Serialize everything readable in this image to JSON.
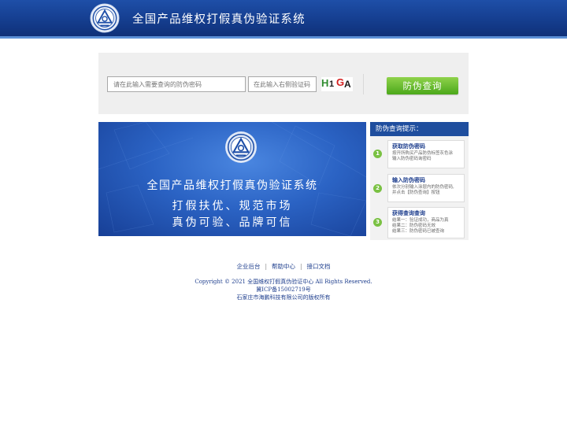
{
  "header": {
    "title": "全国产品维权打假真伪验证系统"
  },
  "search": {
    "code_placeholder": "请在此输入需要查询的防伪密码",
    "verify_placeholder": "在此输入右侧验证码",
    "captcha": [
      "H",
      "1",
      "G",
      "A"
    ],
    "captcha_colors": [
      "#2e8b2e",
      "#1a1a1a",
      "#d42020",
      "#1a1a1a"
    ],
    "button_label": "防伪查询"
  },
  "banner": {
    "title": "全国产品维权打假真伪验证系统",
    "slogan_line1": "打假扶优、规范市场",
    "slogan_line2": "真伪可验、品牌可信"
  },
  "tips": {
    "heading": "防伪查询提示：",
    "items": [
      {
        "num": "1",
        "title": "获取防伪密码",
        "desc1": "按开所购买产品防伪标签灰色涂",
        "desc2": "输入防伪密码询密码",
        "desc3": ""
      },
      {
        "num": "2",
        "title": "输入防伪密码",
        "desc1": "依次分别输入涂层内的防伪密码,",
        "desc2": "并点击【防伪查询】按钮",
        "desc3": ""
      },
      {
        "num": "3",
        "title": "获得查询查询",
        "desc1": "结果一：验证成功，商品为真",
        "desc2": "结果二：防伪密码无效",
        "desc3": "结果三：防伪密码已被查询"
      }
    ]
  },
  "footer": {
    "links": [
      "企业后台",
      "帮助中心",
      "接口文档"
    ],
    "copyright": "Copyright © 2021 全国维权打假真伪验证中心 All Rights Reserved.",
    "icp": "冀ICP备15002719号",
    "owner": "石家庄市海鹏科技有限公司的版权所有"
  },
  "colors": {
    "header_blue": "#153e8f",
    "button_green": "#4ba81a",
    "link_blue": "#1f3f8e"
  }
}
